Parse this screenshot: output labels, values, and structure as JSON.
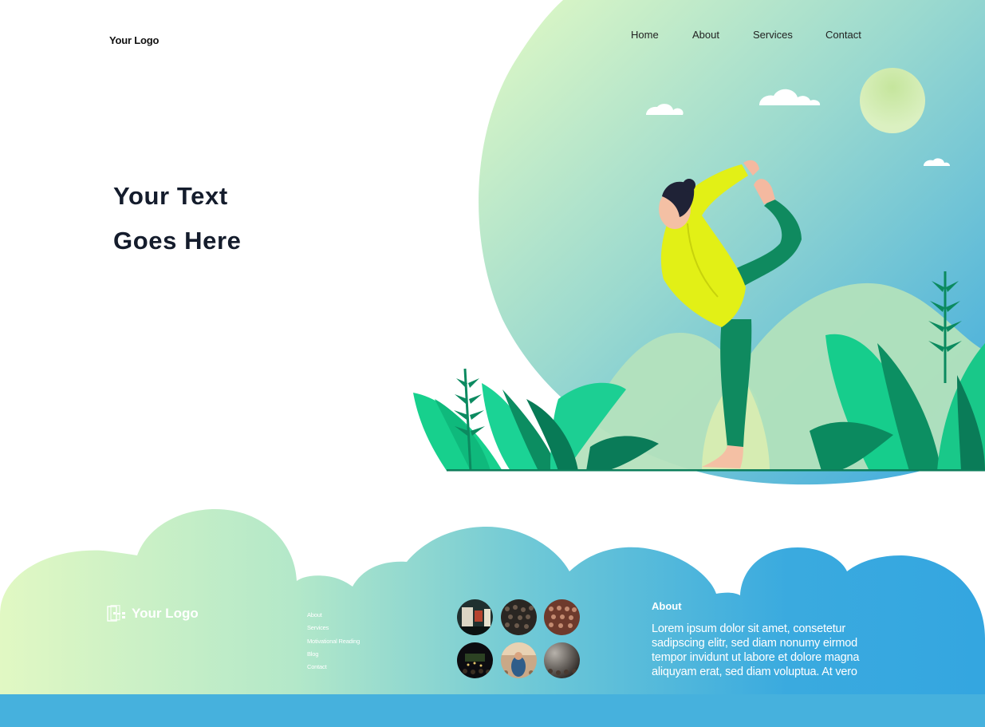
{
  "header": {
    "logo": "Your Logo",
    "nav": [
      {
        "label": "Home"
      },
      {
        "label": "About"
      },
      {
        "label": "Services"
      },
      {
        "label": "Contact"
      }
    ]
  },
  "hero": {
    "line1": "Your Text",
    "line2": "Goes Here",
    "illustration": "woman-yoga-dancer-pose-illustration"
  },
  "footer": {
    "logo": "Your Logo",
    "links": [
      "About",
      "Services",
      "Motivational Reading",
      "Blog",
      "Contact"
    ],
    "gallery_count": 6,
    "about_title": "About",
    "about_text": "Lorem ipsum dolor sit amet, consetetur sadipscing elitr, sed diam nonumy eirmod tempor invidunt ut labore et dolore magna aliquyam erat, sed diam voluptua. At vero"
  },
  "colors": {
    "gradient_start": "#dcf8c6",
    "gradient_end": "#3aa9dd",
    "plant_green": "#1fc98e",
    "plant_dark": "#0a7a55",
    "shirt": "#e2f016",
    "pants": "#0f8a5f",
    "heading": "#141c2c",
    "footer_bar": "#46b1dd"
  }
}
